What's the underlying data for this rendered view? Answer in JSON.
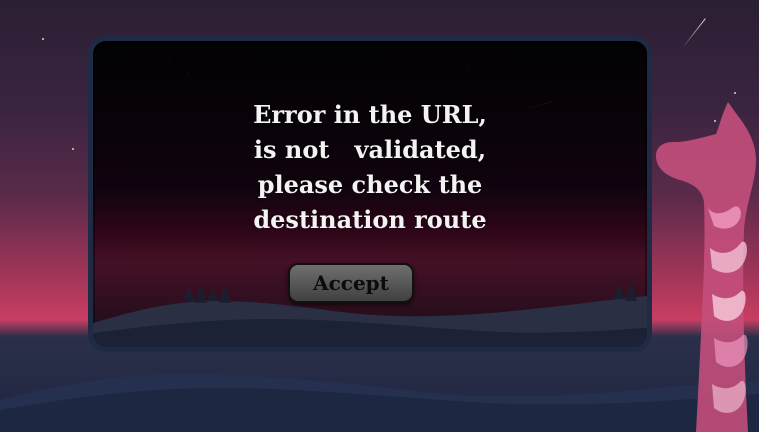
{
  "dialog": {
    "message": "Error in the URL,\nis not   validated,\nplease check the\ndestination route",
    "accept_label": "Accept"
  },
  "colors": {
    "dialog_border": "#1f2a44",
    "button_bg": "#5a5a5a",
    "message_text": "#f3f3f3",
    "sky_top": "#2a1f33",
    "sky_glow": "#c83e62"
  },
  "icons": {
    "background": "night-mountain-landscape",
    "giraffe": "decorative-giraffe"
  }
}
